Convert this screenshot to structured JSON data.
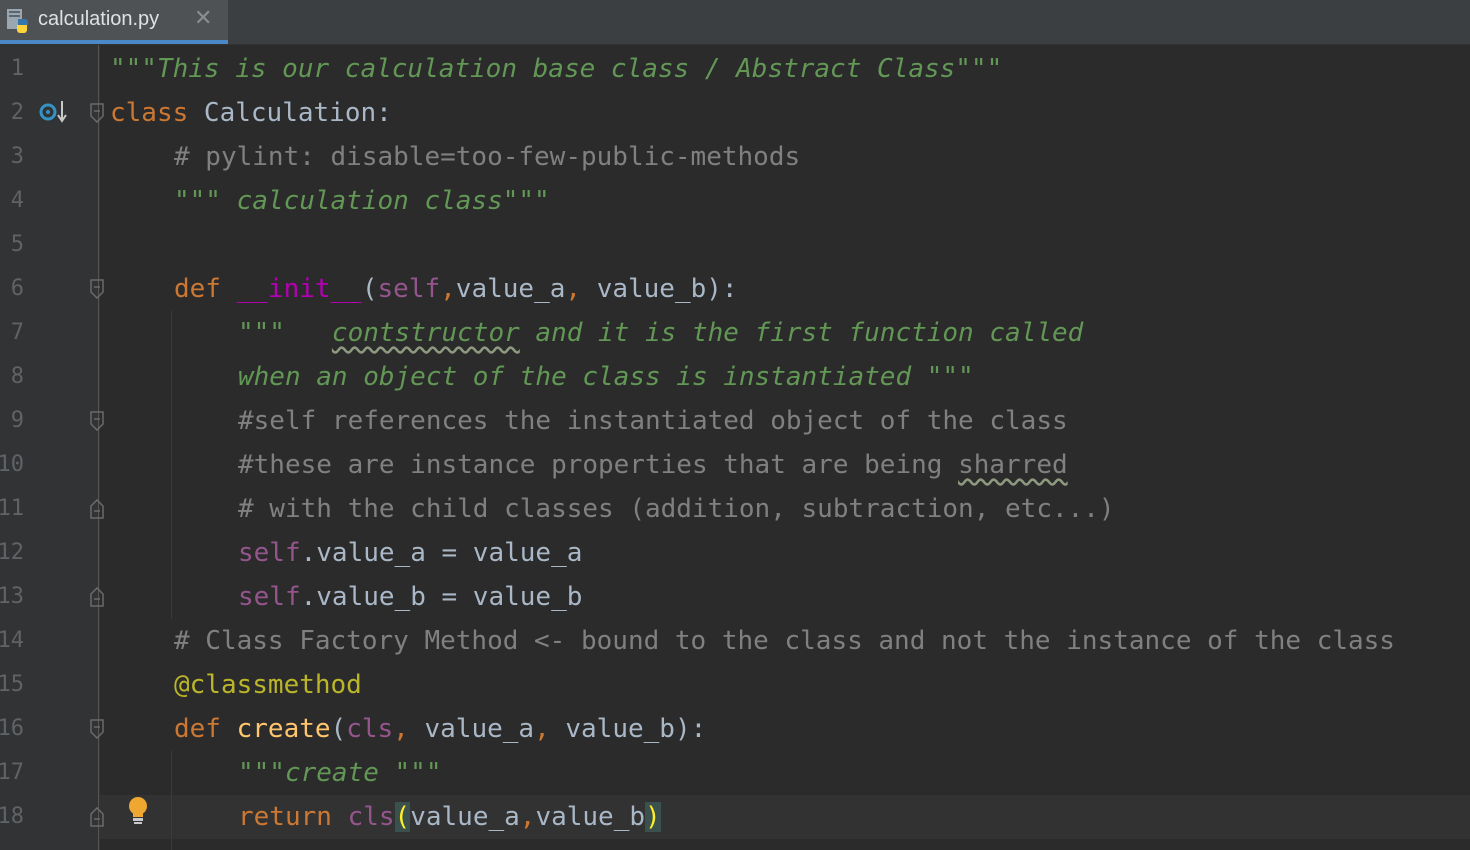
{
  "tab": {
    "label": "calculation.py",
    "close": "✕",
    "icon": "python-file-icon"
  },
  "accent": "#4a88c7",
  "line_numbers": [
    "1",
    "2",
    "3",
    "4",
    "5",
    "6",
    "7",
    "8",
    "9",
    "10",
    "11",
    "12",
    "13",
    "14",
    "15",
    "16",
    "17",
    "18"
  ],
  "code": {
    "l1": {
      "doc": "\"\"\"This is our calculation base class / Abstract Class\"\"\""
    },
    "l2": {
      "kw": "class",
      "name": " Calculation",
      "colon": ":"
    },
    "l3": {
      "comment": "# pylint: disable=too-few-public-methods"
    },
    "l4": {
      "doc": "\"\"\" calculation class\"\"\""
    },
    "l6": {
      "kw": "def ",
      "name": "__init__",
      "p1": "(",
      "self": "self",
      "comma1": ",",
      "a": "value_a",
      "comma2": ", ",
      "b": "value_b",
      "p2": "):"
    },
    "l7": {
      "lead": "\"\"\"   ",
      "typo": "contstructor",
      "rest": " and it is the first function called"
    },
    "l8": {
      "doc": "when an object of the class is instantiated \"\"\""
    },
    "l9": {
      "comment": "#self references the instantiated object of the class"
    },
    "l10": {
      "comment": "#these are instance properties that are being ",
      "typo": "sharred"
    },
    "l11": {
      "comment": "# with the child classes (addition, subtraction, etc...)"
    },
    "l12": {
      "self": "self",
      "rest": ".value_a = value_a"
    },
    "l13": {
      "self": "self",
      "rest": ".value_b = value_b"
    },
    "l14": {
      "comment": "# Class Factory Method <- bound to the class and not the instance of the class"
    },
    "l15": {
      "decorator": "@classmethod"
    },
    "l16": {
      "kw": "def ",
      "name": "create",
      "p1": "(",
      "cls": "cls",
      "comma1": ", ",
      "a": "value_a",
      "comma2": ", ",
      "b": "value_b",
      "p2": "):"
    },
    "l17": {
      "doc": "\"\"\"create \"\"\""
    },
    "l18": {
      "kw": "return ",
      "cls": "cls",
      "p1": "(",
      "a": "value_a",
      "comma": ",",
      "b": "value_b",
      "p2": ")"
    }
  },
  "icons": {
    "override": "override-method-icon",
    "bulb": "lightbulb-icon",
    "fold": "fold-marker-icon"
  }
}
